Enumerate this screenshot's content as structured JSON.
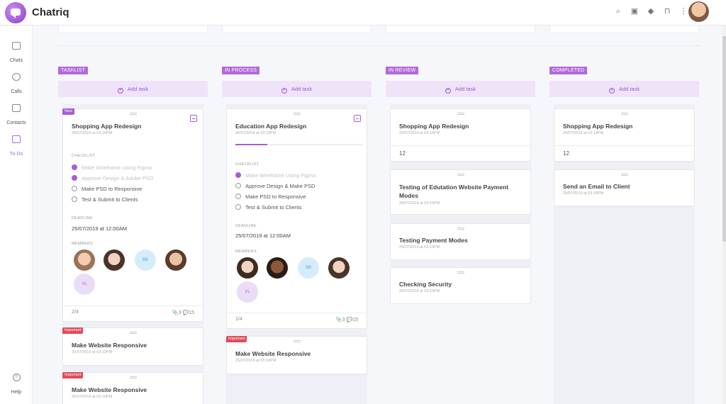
{
  "app": {
    "name": "Chatriq"
  },
  "topbar": {
    "icons": [
      "search-icon",
      "bookmark-icon",
      "diamond-icon",
      "shirt-icon",
      "more-icon"
    ]
  },
  "sidebar": {
    "items": [
      {
        "label": "Chats",
        "icon": "chat-icon",
        "active": false
      },
      {
        "label": "Calls",
        "icon": "phone-icon",
        "active": false
      },
      {
        "label": "Contacts",
        "icon": "contacts-icon",
        "active": false
      },
      {
        "label": "To-Do",
        "icon": "todo-icon",
        "active": true
      }
    ],
    "help_label": "Help"
  },
  "board": {
    "add_task_label": "Add task",
    "columns": [
      {
        "tag": "TASKLIST",
        "cards": [
          {
            "pill": "New",
            "title": "Shopping App Redesign",
            "date": "25/07/2019 at 03:10PM",
            "checklist_label": "CHECKLIST",
            "checklist": [
              {
                "text": "Make Wireframe Using Figma",
                "done": true
              },
              {
                "text": "Approve Design & Adobe PSD",
                "done": true
              },
              {
                "text": "Make PSD to Responsive",
                "done": false
              },
              {
                "text": "Test & Submit to Clients",
                "done": false
              }
            ],
            "deadline_label": "DEADLINE",
            "deadline": "25/07/2019 at 12:00AM",
            "members_label": "MEMBERS",
            "members": [
              "",
              "",
              "BB",
              "",
              "VL"
            ],
            "progress": "2/4",
            "attachments": "3",
            "comments": "15"
          },
          {
            "pill": "Important",
            "title": "Make Website Responsive",
            "date": "25/07/2019 at 03:10PM"
          },
          {
            "pill": "Important",
            "title": "Make Website Responsive",
            "date": "25/07/2019 at 03:10PM"
          }
        ]
      },
      {
        "tag": "IN PROCESS",
        "cards": [
          {
            "title": "Education App Redesign",
            "date": "25/07/2019 at 03:10PM",
            "progress_fill": 0.25,
            "checklist_label": "CHECKLIST",
            "checklist": [
              {
                "text": "Make Wireframe Using Figma",
                "done": true
              },
              {
                "text": "Approve Design & Make PSD",
                "done": false
              },
              {
                "text": "Make PSD to Responsive",
                "done": false
              },
              {
                "text": "Test & Submit to Clients",
                "done": false
              }
            ],
            "deadline_label": "DEADLINE",
            "deadline": "25/07/2019 at 12:00AM",
            "members_label": "MEMBERS",
            "members": [
              "",
              "",
              "BB",
              "",
              "VL"
            ],
            "progress": "1/4",
            "attachments": "3",
            "comments": "15"
          },
          {
            "pill": "Important",
            "title": "Make Website Responsive",
            "date": "25/07/2019 at 03:10PM"
          }
        ]
      },
      {
        "tag": "IN REVIEW",
        "cards": [
          {
            "title": "Shopping App Redesign",
            "date": "25/07/2019 at 03:10PM",
            "count": "12"
          },
          {
            "title": "Testing of Edutation Website Payment Modes",
            "date": "25/07/2019 at 03:10PM"
          },
          {
            "title": "Testing Payment Modes",
            "date": "25/07/2019 at 03:10PM"
          },
          {
            "title": "Checking Security",
            "date": "25/07/2019 at 03:10PM"
          }
        ]
      },
      {
        "tag": "COMPLETED",
        "cards": [
          {
            "title": "Shopping App Redesign",
            "date": "25/07/2019 at 03:10PM",
            "count": "12"
          },
          {
            "title": "Send an Email to Client",
            "date": "25/07/2019 at 03:10PM"
          }
        ]
      }
    ]
  },
  "colors": {
    "accent": "#a85cd8",
    "important": "#e04b5a",
    "add_task_bg": "#efe3fa"
  }
}
